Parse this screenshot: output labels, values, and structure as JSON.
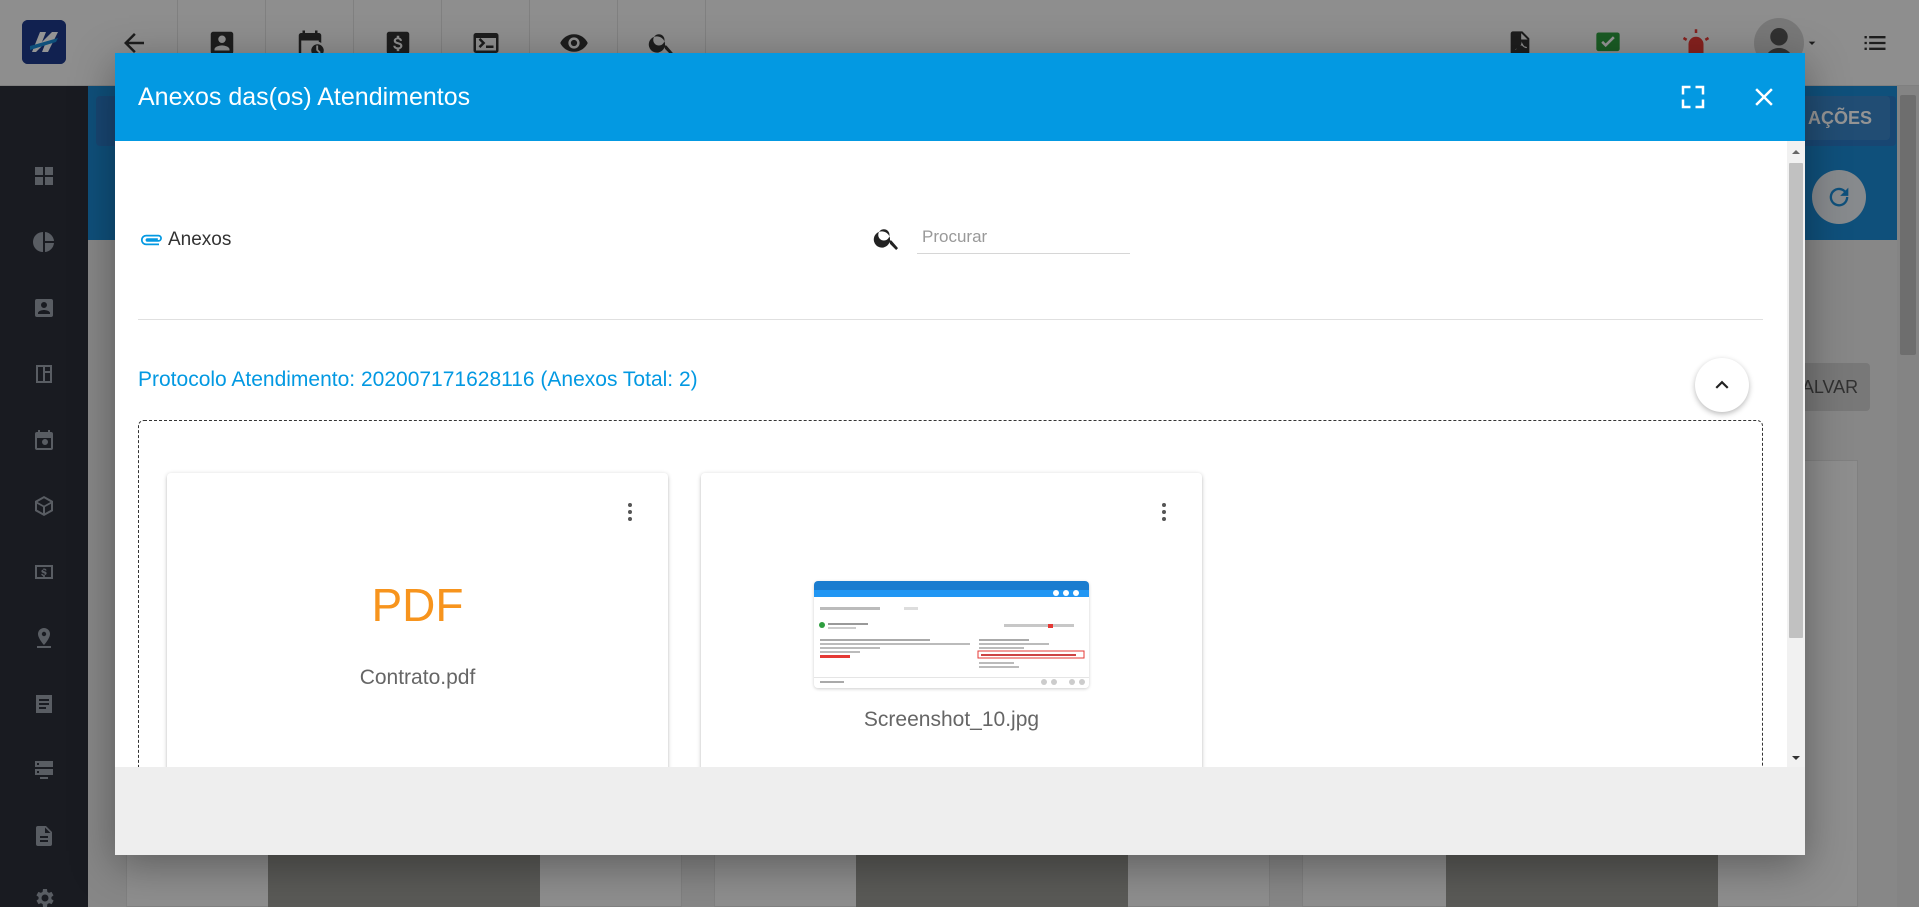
{
  "background": {
    "acoes_label": "AÇÕES",
    "salvar_label": "ALVAR"
  },
  "modal": {
    "title": "Anexos das(os) Atendimentos",
    "anexos_label": "Anexos",
    "search": {
      "placeholder": "Procurar",
      "value": ""
    },
    "protocol_heading": "Protocolo Atendimento: 202007171628116 (Anexos Total: 2)",
    "files": [
      {
        "type_label": "PDF",
        "name": "Contrato.pdf",
        "kind": "pdf"
      },
      {
        "name": "Screenshot_10.jpg",
        "kind": "image"
      }
    ]
  },
  "colors": {
    "header": "#0399e2",
    "pdf_accent": "#f7941d",
    "sidebar": "#2c2f3a"
  }
}
